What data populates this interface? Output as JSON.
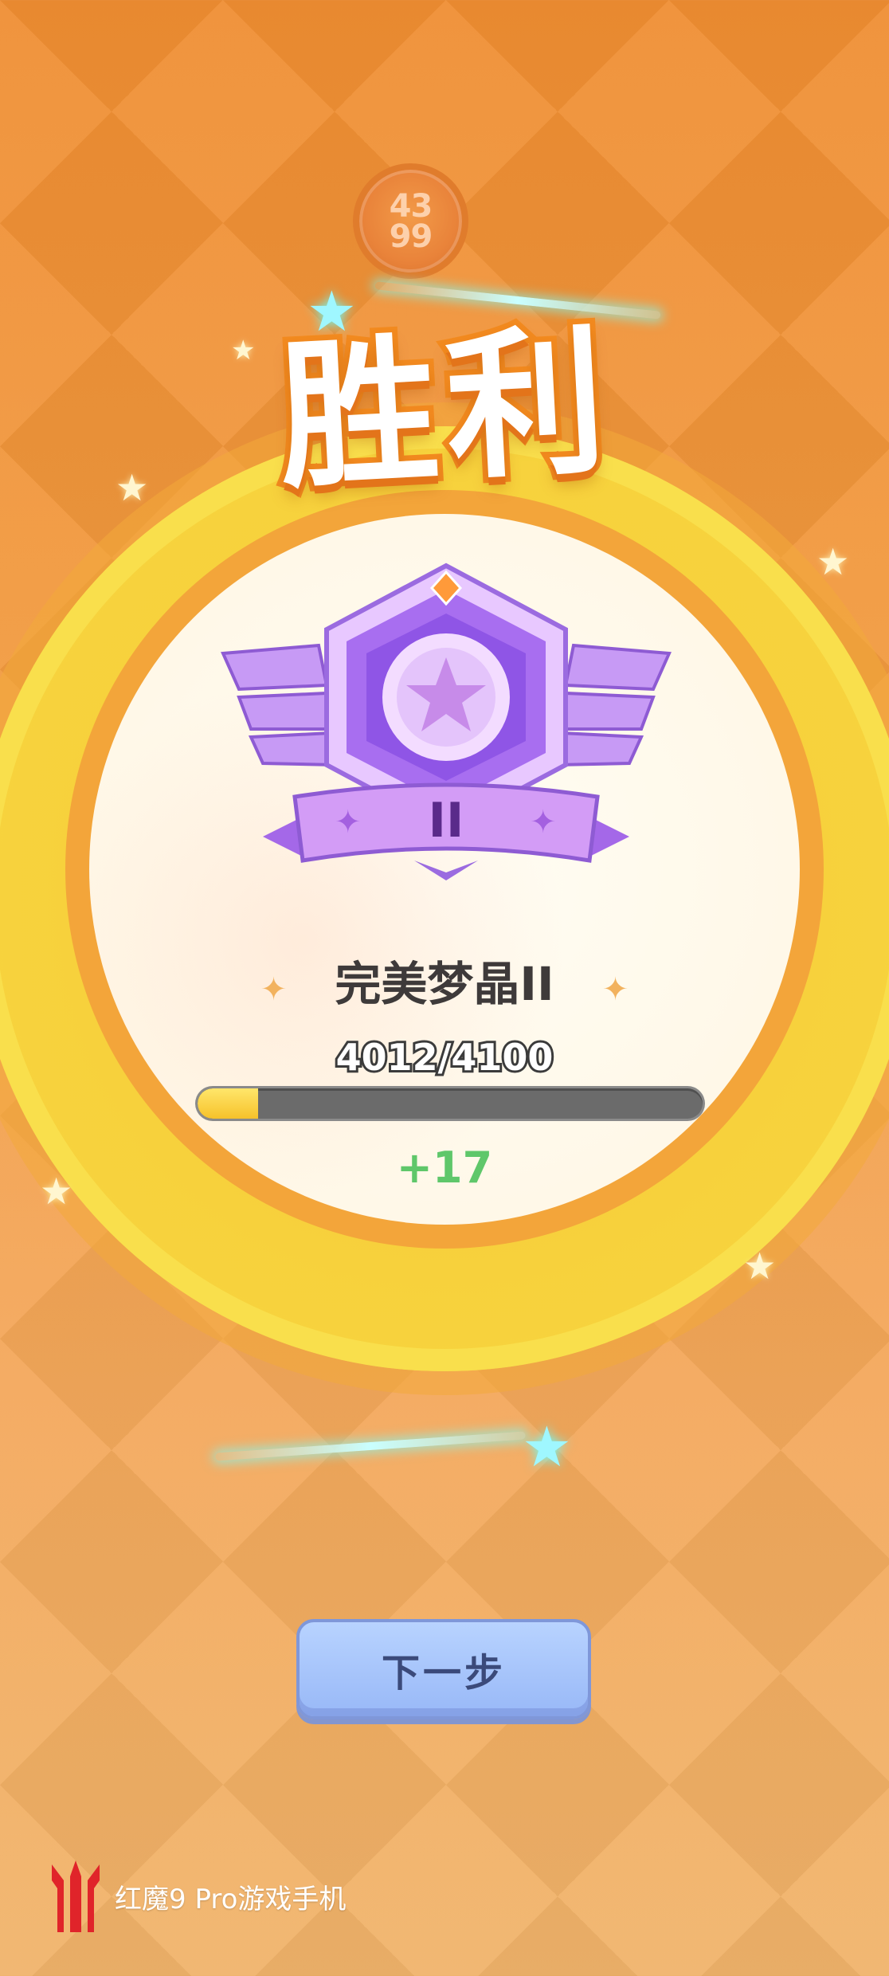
{
  "logo": {
    "line1": "43",
    "line2": "99"
  },
  "result": {
    "title": "胜利"
  },
  "rank": {
    "tier_roman": "II",
    "name": "完美梦晶II",
    "progress_text": "4012/4100",
    "progress_fraction": 0.12,
    "gain": "+17"
  },
  "actions": {
    "next_label": "下一步"
  },
  "watermark": {
    "text": "红魔9 Pro游戏手机"
  },
  "colors": {
    "background": "#ef8d32",
    "ring": "#f7d33d",
    "badge_primary": "#b47af0",
    "progress_fill": "#f6c22a",
    "gain": "#5fc76a",
    "button": "#a9c6fb"
  }
}
